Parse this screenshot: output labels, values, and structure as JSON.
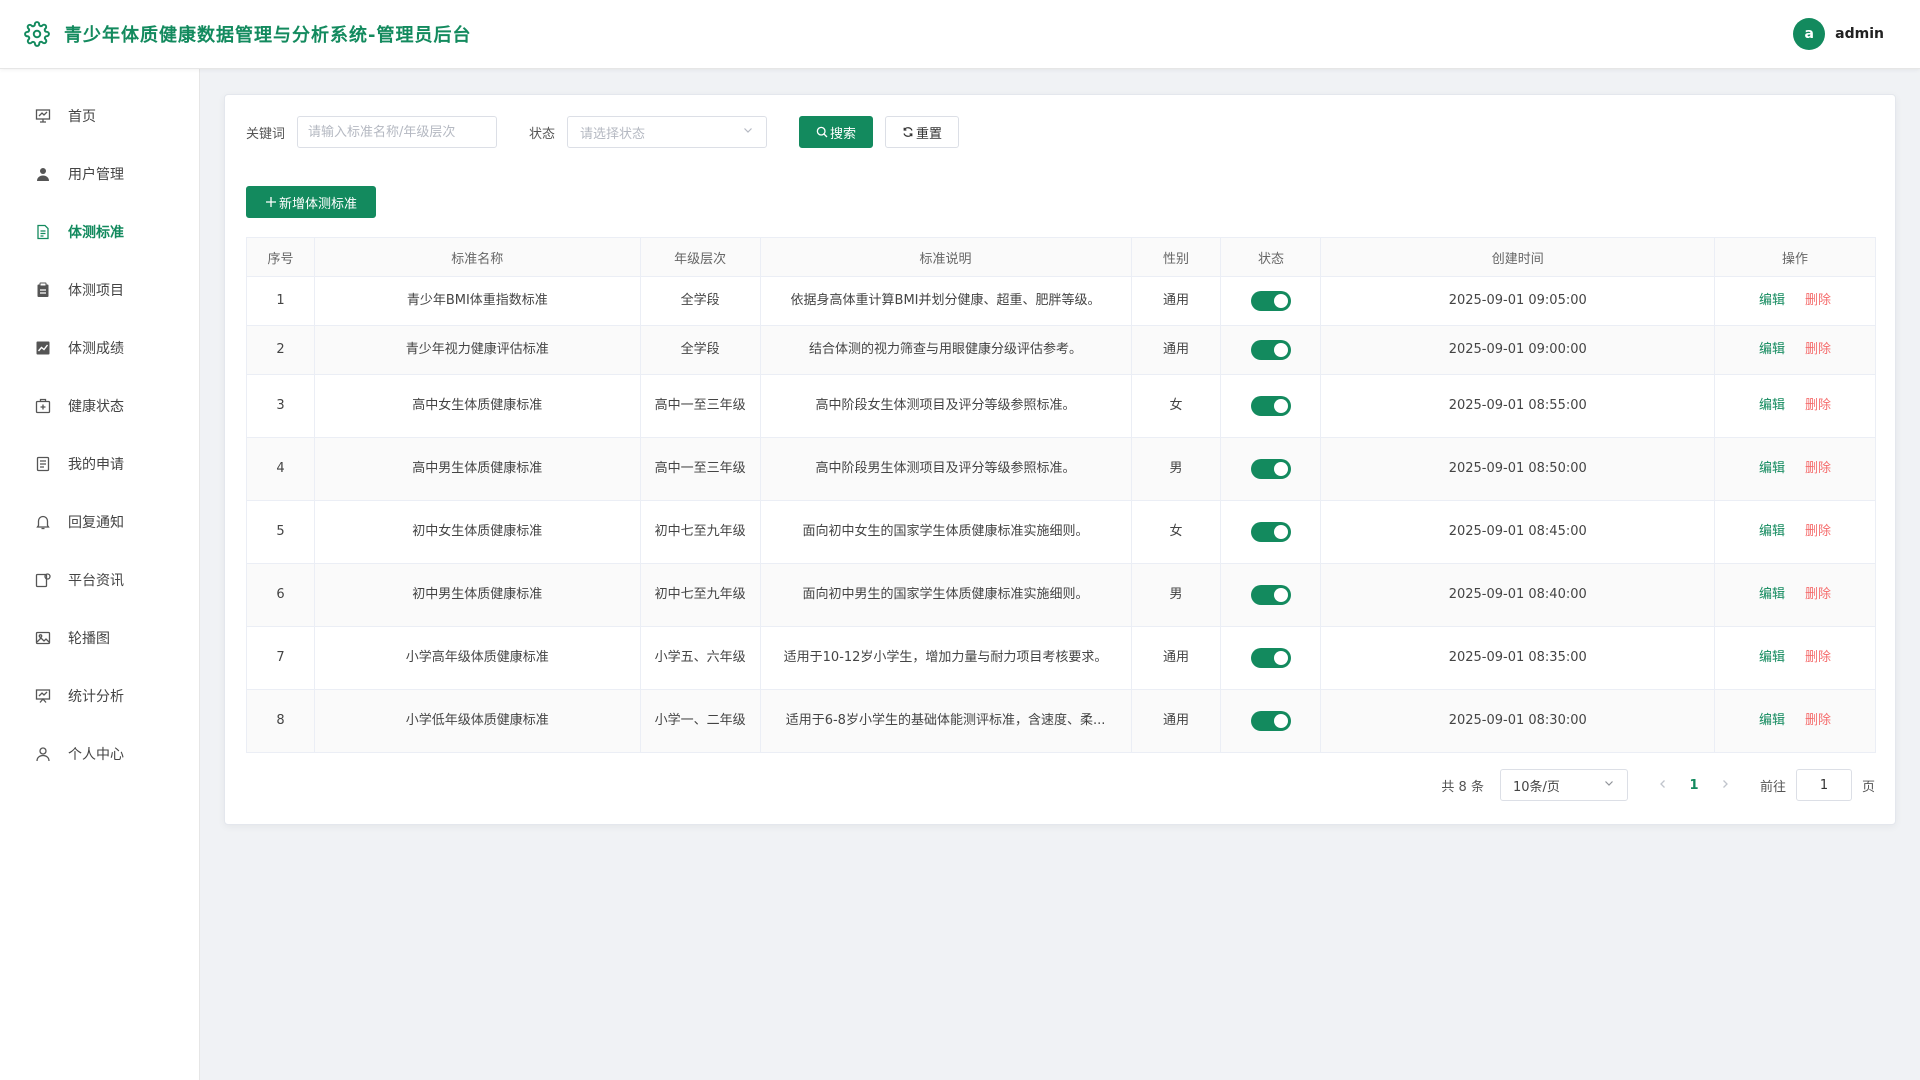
{
  "app": {
    "title": "青少年体质健康数据管理与分析系统-管理员后台"
  },
  "user": {
    "avatar_letter": "a",
    "name": "admin"
  },
  "sidebar": {
    "items": [
      {
        "label": "首页",
        "icon": "monitor-icon"
      },
      {
        "label": "用户管理",
        "icon": "user-icon"
      },
      {
        "label": "体测标准",
        "icon": "document-icon",
        "active": true
      },
      {
        "label": "体测项目",
        "icon": "clipboard-icon"
      },
      {
        "label": "体测成绩",
        "icon": "chart-icon"
      },
      {
        "label": "健康状态",
        "icon": "medical-box-icon"
      },
      {
        "label": "我的申请",
        "icon": "form-icon"
      },
      {
        "label": "回复通知",
        "icon": "bell-icon"
      },
      {
        "label": "平台资讯",
        "icon": "news-icon"
      },
      {
        "label": "轮播图",
        "icon": "picture-icon"
      },
      {
        "label": "统计分析",
        "icon": "presentation-icon"
      },
      {
        "label": "个人中心",
        "icon": "profile-icon"
      }
    ]
  },
  "search": {
    "keyword_label": "关键词",
    "keyword_placeholder": "请输入标准名称/年级层次",
    "status_label": "状态",
    "status_placeholder": "请选择状态",
    "search_button": "搜索",
    "reset_button": "重置"
  },
  "toolbar": {
    "add_button": "新增体测标准"
  },
  "table": {
    "headers": [
      "序号",
      "标准名称",
      "年级层次",
      "标准说明",
      "性别",
      "状态",
      "创建时间",
      "操作"
    ],
    "edit_label": "编辑",
    "delete_label": "删除",
    "rows": [
      {
        "index": "1",
        "name": "青少年BMI体重指数标准",
        "grade": "全学段",
        "desc": "依据身高体重计算BMI并划分健康、超重、肥胖等级。",
        "gender": "通用",
        "enabled": true,
        "created": "2025-09-01 09:05:00"
      },
      {
        "index": "2",
        "name": "青少年视力健康评估标准",
        "grade": "全学段",
        "desc": "结合体测的视力筛查与用眼健康分级评估参考。",
        "gender": "通用",
        "enabled": true,
        "created": "2025-09-01 09:00:00"
      },
      {
        "index": "3",
        "name": "高中女生体质健康标准",
        "grade": "高中一至三年级",
        "desc": "高中阶段女生体测项目及评分等级参照标准。",
        "gender": "女",
        "enabled": true,
        "created": "2025-09-01 08:55:00"
      },
      {
        "index": "4",
        "name": "高中男生体质健康标准",
        "grade": "高中一至三年级",
        "desc": "高中阶段男生体测项目及评分等级参照标准。",
        "gender": "男",
        "enabled": true,
        "created": "2025-09-01 08:50:00"
      },
      {
        "index": "5",
        "name": "初中女生体质健康标准",
        "grade": "初中七至九年级",
        "desc": "面向初中女生的国家学生体质健康标准实施细则。",
        "gender": "女",
        "enabled": true,
        "created": "2025-09-01 08:45:00"
      },
      {
        "index": "6",
        "name": "初中男生体质健康标准",
        "grade": "初中七至九年级",
        "desc": "面向初中男生的国家学生体质健康标准实施细则。",
        "gender": "男",
        "enabled": true,
        "created": "2025-09-01 08:40:00"
      },
      {
        "index": "7",
        "name": "小学高年级体质健康标准",
        "grade": "小学五、六年级",
        "desc": "适用于10-12岁小学生，增加力量与耐力项目考核要求。",
        "gender": "通用",
        "enabled": true,
        "created": "2025-09-01 08:35:00"
      },
      {
        "index": "8",
        "name": "小学低年级体质健康标准",
        "grade": "小学一、二年级",
        "desc": "适用于6-8岁小学生的基础体能测评标准，含速度、柔...",
        "gender": "通用",
        "enabled": true,
        "created": "2025-09-01 08:30:00"
      }
    ]
  },
  "pagination": {
    "total_text": "共 8 条",
    "page_size": "10条/页",
    "current_page": "1",
    "goto_label": "前往",
    "goto_value": "1",
    "goto_suffix": "页"
  },
  "colors": {
    "primary": "#138a5e",
    "danger": "#f56c6c"
  }
}
